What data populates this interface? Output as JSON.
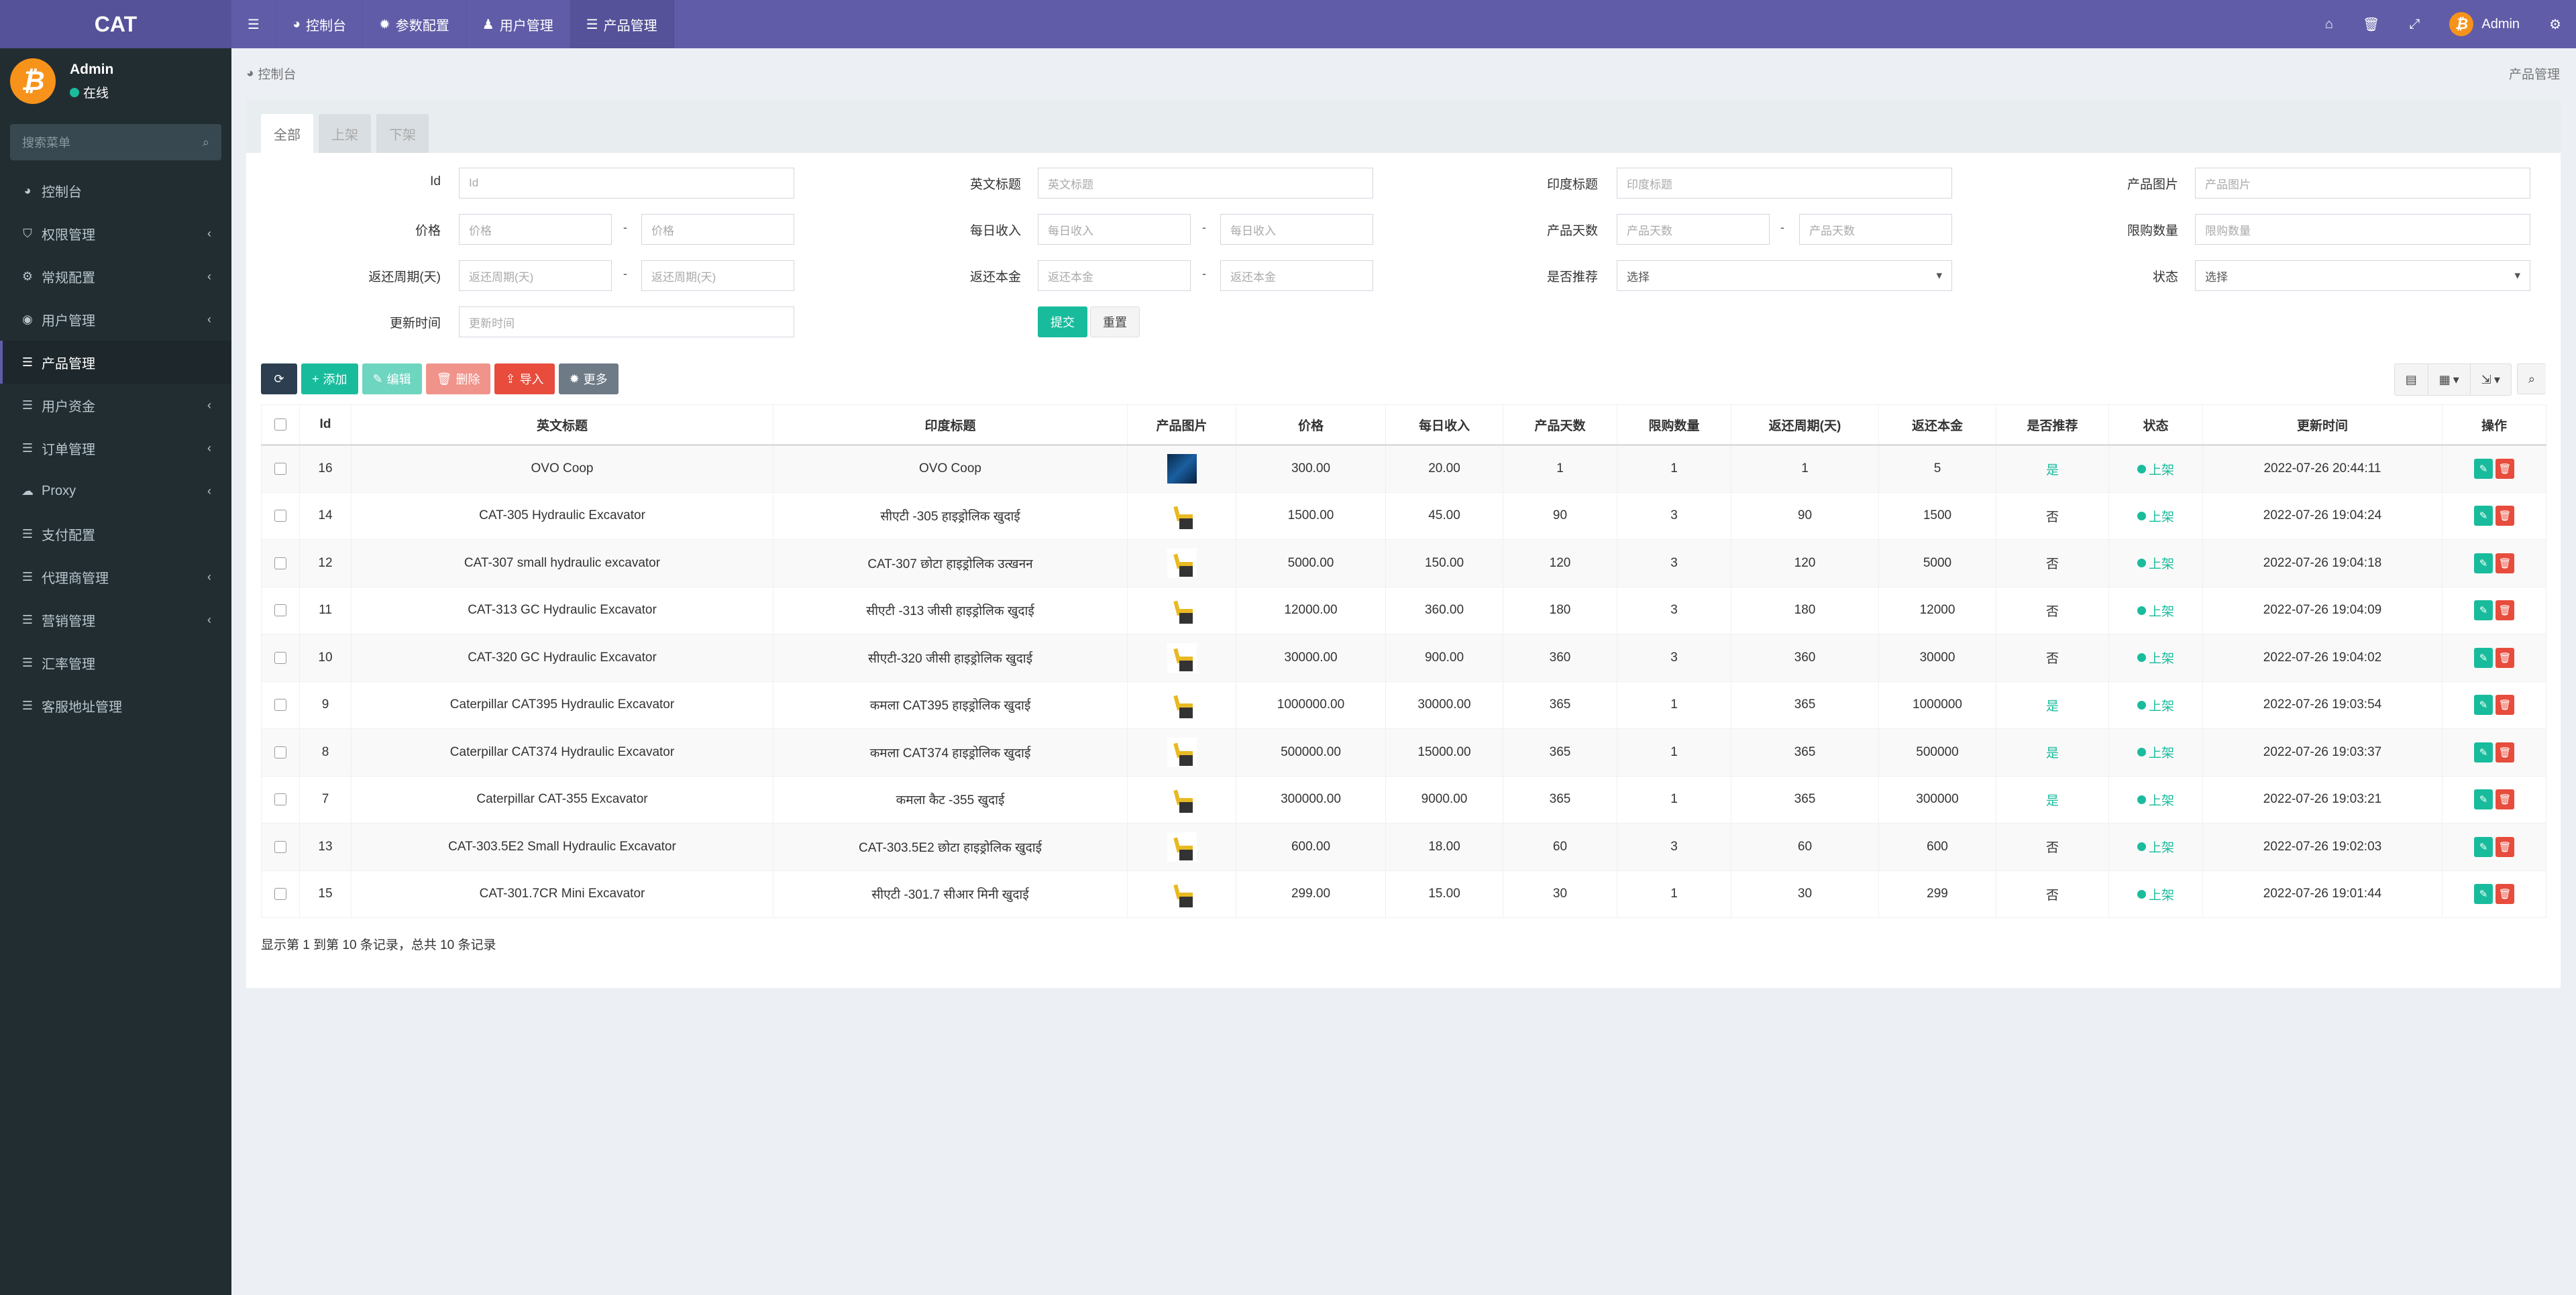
{
  "app": {
    "logo": "CAT"
  },
  "topnav": {
    "items": [
      {
        "label": "控制台",
        "icon": "dashboard-icon"
      },
      {
        "label": "参数配置",
        "icon": "gear-icon"
      },
      {
        "label": "用户管理",
        "icon": "user-icon"
      },
      {
        "label": "产品管理",
        "icon": "list-icon"
      }
    ],
    "user_name": "Admin"
  },
  "sidebar": {
    "user_name": "Admin",
    "status": "在线",
    "search_placeholder": "搜索菜单",
    "items": [
      {
        "label": "控制台",
        "icon": "dashboard-icon",
        "has_children": false
      },
      {
        "label": "权限管理",
        "icon": "shield-icon",
        "has_children": true
      },
      {
        "label": "常规配置",
        "icon": "gears-icon",
        "has_children": true
      },
      {
        "label": "用户管理",
        "icon": "user-circle-icon",
        "has_children": true
      },
      {
        "label": "产品管理",
        "icon": "list-icon",
        "has_children": false,
        "active": true
      },
      {
        "label": "用户资金",
        "icon": "list-icon",
        "has_children": true
      },
      {
        "label": "订单管理",
        "icon": "list-icon",
        "has_children": true
      },
      {
        "label": "Proxy",
        "icon": "cloud-icon",
        "has_children": true
      },
      {
        "label": "支付配置",
        "icon": "list-icon",
        "has_children": false
      },
      {
        "label": "代理商管理",
        "icon": "list-icon",
        "has_children": true
      },
      {
        "label": "营销管理",
        "icon": "list-icon",
        "has_children": true
      },
      {
        "label": "汇率管理",
        "icon": "list-icon",
        "has_children": false
      },
      {
        "label": "客服地址管理",
        "icon": "list-icon",
        "has_children": false
      }
    ]
  },
  "breadcrumb": {
    "current": "控制台",
    "right": "产品管理"
  },
  "tabs": [
    {
      "label": "全部",
      "active": true
    },
    {
      "label": "上架",
      "active": false
    },
    {
      "label": "下架",
      "active": false
    }
  ],
  "filters": {
    "id": {
      "label": "Id",
      "placeholder": "Id"
    },
    "en_title": {
      "label": "英文标题",
      "placeholder": "英文标题"
    },
    "in_title": {
      "label": "印度标题",
      "placeholder": "印度标题"
    },
    "image": {
      "label": "产品图片",
      "placeholder": "产品图片"
    },
    "price": {
      "label": "价格",
      "placeholder": "价格"
    },
    "daily": {
      "label": "每日收入",
      "placeholder": "每日收入"
    },
    "days": {
      "label": "产品天数",
      "placeholder": "产品天数"
    },
    "limit": {
      "label": "限购数量",
      "placeholder": "限购数量"
    },
    "cycle": {
      "label": "返还周期(天)",
      "placeholder": "返还周期(天)"
    },
    "principal": {
      "label": "返还本金",
      "placeholder": "返还本金"
    },
    "recommend": {
      "label": "是否推荐",
      "value": "选择"
    },
    "status": {
      "label": "状态",
      "value": "选择"
    },
    "updated": {
      "label": "更新时间",
      "placeholder": "更新时间"
    },
    "dash": "-",
    "submit": "提交",
    "reset": "重置"
  },
  "toolbar": {
    "add": "添加",
    "edit": "编辑",
    "delete": "删除",
    "import": "导入",
    "more": "更多"
  },
  "table": {
    "columns": [
      "Id",
      "英文标题",
      "印度标题",
      "产品图片",
      "价格",
      "每日收入",
      "产品天数",
      "限购数量",
      "返还周期(天)",
      "返还本金",
      "是否推荐",
      "状态",
      "更新时间",
      "操作"
    ],
    "rows": [
      {
        "id": "16",
        "en": "OVO Coop",
        "in": "OVO Coop",
        "img": "blue",
        "price": "300.00",
        "daily": "20.00",
        "days": "1",
        "limit": "1",
        "cycle": "1",
        "principal": "5",
        "recommend": "是",
        "rec_yes": true,
        "status": "上架",
        "updated": "2022-07-26 20:44:11"
      },
      {
        "id": "14",
        "en": "CAT-305 Hydraulic Excavator",
        "in": "सीएटी -305 हाइड्रोलिक खुदाई",
        "img": "exc",
        "price": "1500.00",
        "daily": "45.00",
        "days": "90",
        "limit": "3",
        "cycle": "90",
        "principal": "1500",
        "recommend": "否",
        "rec_yes": false,
        "status": "上架",
        "updated": "2022-07-26 19:04:24"
      },
      {
        "id": "12",
        "en": "CAT-307 small hydraulic excavator",
        "in": "CAT-307 छोटा हाइड्रोलिक उत्खनन",
        "img": "exc",
        "price": "5000.00",
        "daily": "150.00",
        "days": "120",
        "limit": "3",
        "cycle": "120",
        "principal": "5000",
        "recommend": "否",
        "rec_yes": false,
        "status": "上架",
        "updated": "2022-07-26 19:04:18"
      },
      {
        "id": "11",
        "en": "CAT-313 GC Hydraulic Excavator",
        "in": "सीएटी -313 जीसी हाइड्रोलिक खुदाई",
        "img": "exc",
        "price": "12000.00",
        "daily": "360.00",
        "days": "180",
        "limit": "3",
        "cycle": "180",
        "principal": "12000",
        "recommend": "否",
        "rec_yes": false,
        "status": "上架",
        "updated": "2022-07-26 19:04:09"
      },
      {
        "id": "10",
        "en": "CAT-320 GC Hydraulic Excavator",
        "in": "सीएटी-320 जीसी हाइड्रोलिक खुदाई",
        "img": "exc",
        "price": "30000.00",
        "daily": "900.00",
        "days": "360",
        "limit": "3",
        "cycle": "360",
        "principal": "30000",
        "recommend": "否",
        "rec_yes": false,
        "status": "上架",
        "updated": "2022-07-26 19:04:02"
      },
      {
        "id": "9",
        "en": "Caterpillar CAT395 Hydraulic Excavator",
        "in": "कमला CAT395 हाइड्रोलिक खुदाई",
        "img": "exc",
        "price": "1000000.00",
        "daily": "30000.00",
        "days": "365",
        "limit": "1",
        "cycle": "365",
        "principal": "1000000",
        "recommend": "是",
        "rec_yes": true,
        "status": "上架",
        "updated": "2022-07-26 19:03:54"
      },
      {
        "id": "8",
        "en": "Caterpillar CAT374 Hydraulic Excavator",
        "in": "कमला CAT374 हाइड्रोलिक खुदाई",
        "img": "exc",
        "price": "500000.00",
        "daily": "15000.00",
        "days": "365",
        "limit": "1",
        "cycle": "365",
        "principal": "500000",
        "recommend": "是",
        "rec_yes": true,
        "status": "上架",
        "updated": "2022-07-26 19:03:37"
      },
      {
        "id": "7",
        "en": "Caterpillar CAT-355 Excavator",
        "in": "कमला कैट -355 खुदाई",
        "img": "exc",
        "price": "300000.00",
        "daily": "9000.00",
        "days": "365",
        "limit": "1",
        "cycle": "365",
        "principal": "300000",
        "recommend": "是",
        "rec_yes": true,
        "status": "上架",
        "updated": "2022-07-26 19:03:21"
      },
      {
        "id": "13",
        "en": "CAT-303.5E2 Small Hydraulic Excavator",
        "in": "CAT-303.5E2 छोटा हाइड्रोलिक खुदाई",
        "img": "exc",
        "price": "600.00",
        "daily": "18.00",
        "days": "60",
        "limit": "3",
        "cycle": "60",
        "principal": "600",
        "recommend": "否",
        "rec_yes": false,
        "status": "上架",
        "updated": "2022-07-26 19:02:03"
      },
      {
        "id": "15",
        "en": "CAT-301.7CR Mini Excavator",
        "in": "सीएटी -301.7 सीआर मिनी खुदाई",
        "img": "exc",
        "price": "299.00",
        "daily": "15.00",
        "days": "30",
        "limit": "1",
        "cycle": "30",
        "principal": "299",
        "recommend": "否",
        "rec_yes": false,
        "status": "上架",
        "updated": "2022-07-26 19:01:44"
      }
    ]
  },
  "pagination_info": "显示第 1 到第 10 条记录，总共 10 条记录",
  "colors": {
    "brand": "#605ca8",
    "sidebar": "#222d32",
    "success": "#18bc9c",
    "danger": "#e74c3c",
    "bitcoin": "#f7931a"
  }
}
